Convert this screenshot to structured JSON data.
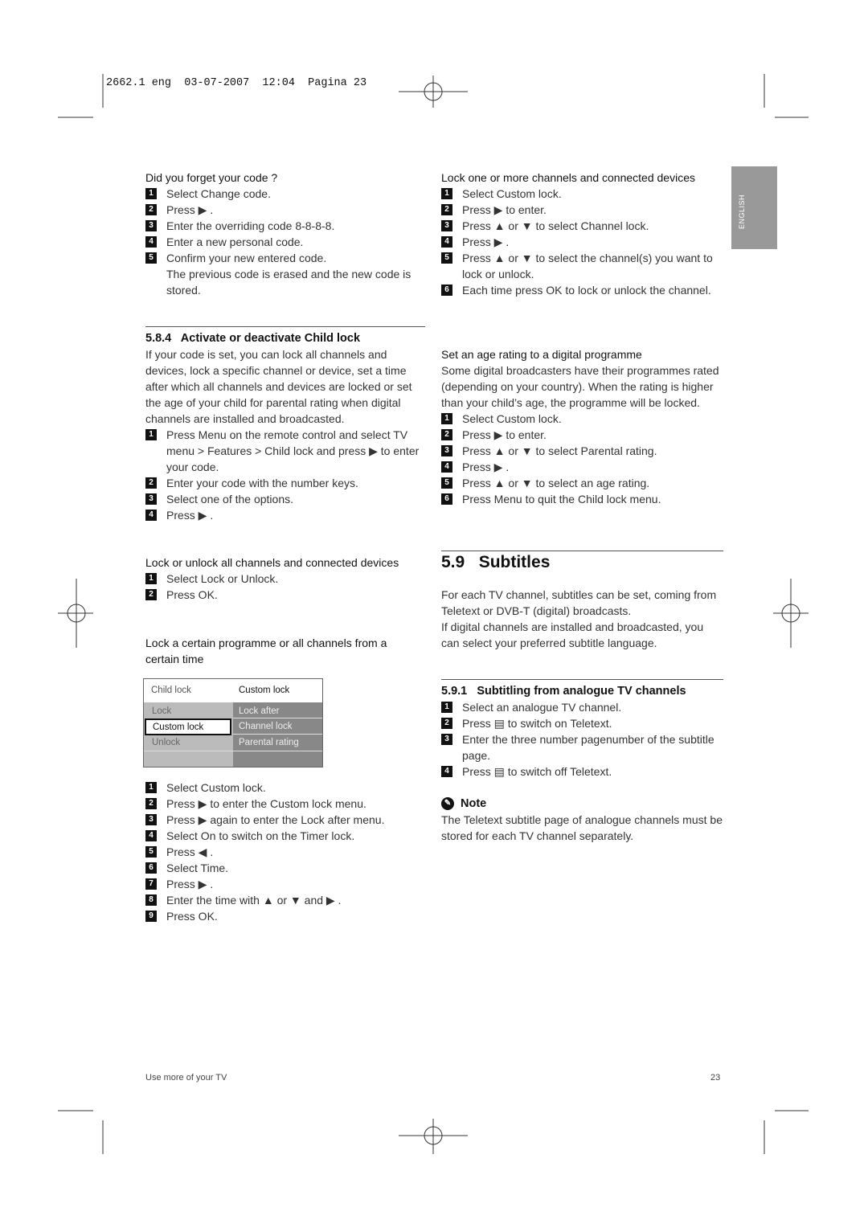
{
  "slug": "2662.1 eng  03-07-2007  12:04  Pagina 23",
  "side_tab": "ENGLISH",
  "left": {
    "forget": {
      "title": "Did you forget your code ?",
      "steps": [
        "Select Change code.",
        "Press ▶ .",
        "Enter the overriding code 8-8-8-8.",
        "Enter a new personal code.",
        "Confirm your new entered code."
      ],
      "after": "The previous code is erased and the new code is stored."
    },
    "activate": {
      "heading": "5.8.4   Activate or deactivate Child lock",
      "para": "If your code is set, you can lock all channels and devices, lock a specific channel or device, set a time after which all channels and devices are locked or set the age of your child for parental rating when digital channels are installed and broadcasted.",
      "steps": [
        "Press Menu on the remote control and select TV menu > Features > Child lock and press ▶ to enter your code.",
        "Enter your code with the number keys.",
        "Select one of the options.",
        "Press ▶ ."
      ]
    },
    "lockall": {
      "title": "Lock or unlock all channels and connected devices",
      "steps": [
        "Select Lock or Unlock.",
        "Press OK."
      ]
    },
    "locktime": {
      "title": "Lock a certain programme or all channels from a certain time",
      "steps": [
        "Select Custom lock.",
        "Press ▶ to enter the Custom lock menu.",
        "Press ▶ again to enter the Lock after menu.",
        "Select On to switch on the Timer lock.",
        "Press ◀ .",
        "Select Time.",
        "Press ▶ .",
        "Enter the time with ▲ or ▼ and ▶ .",
        "Press OK."
      ]
    },
    "menu": {
      "header_left": "Child lock",
      "header_right": "Custom lock",
      "left_items": [
        "Lock",
        "Custom lock",
        "Unlock"
      ],
      "right_items": [
        "Lock after",
        "Channel lock",
        "Parental rating"
      ],
      "selected": "Custom lock"
    }
  },
  "right": {
    "lockone": {
      "title": "Lock one or more channels and connected devices",
      "steps": [
        "Select Custom lock.",
        "Press ▶ to enter.",
        "Press ▲ or ▼ to select Channel lock.",
        "Press ▶ .",
        "Press ▲ or ▼ to select the channel(s) you want to lock or unlock.",
        "Each time press OK to lock or unlock the channel."
      ]
    },
    "age": {
      "title": "Set an age rating to a digital programme",
      "para": "Some digital broadcasters have their programmes rated (depending on your country). When the rating is higher than your child’s age, the programme will be locked.",
      "steps": [
        "Select Custom lock.",
        "Press ▶ to enter.",
        "Press ▲ or ▼ to select Parental rating.",
        "Press ▶ .",
        "Press ▲ or ▼ to select an age rating.",
        "Press Menu to quit the Child lock menu."
      ]
    },
    "subtitles": {
      "heading": "5.9   Subtitles",
      "para1": "For each TV channel, subtitles can be set, coming from Teletext or DVB-T (digital) broadcasts.",
      "para2": "If digital channels are installed and broadcasted, you can select your preferred subtitle language."
    },
    "analogue": {
      "heading": "5.9.1   Subtitling from analogue TV channels",
      "steps": [
        "Select an analogue TV channel.",
        "Press ▤ to switch on Teletext.",
        "Enter the three number pagenumber of the subtitle page.",
        "Press ▤ to switch off Teletext."
      ]
    },
    "note": {
      "label": "Note",
      "text": "The Teletext subtitle page of analogue channels must be stored for each TV channel separately."
    }
  },
  "footer": {
    "left": "Use more of your TV",
    "page": "23"
  }
}
